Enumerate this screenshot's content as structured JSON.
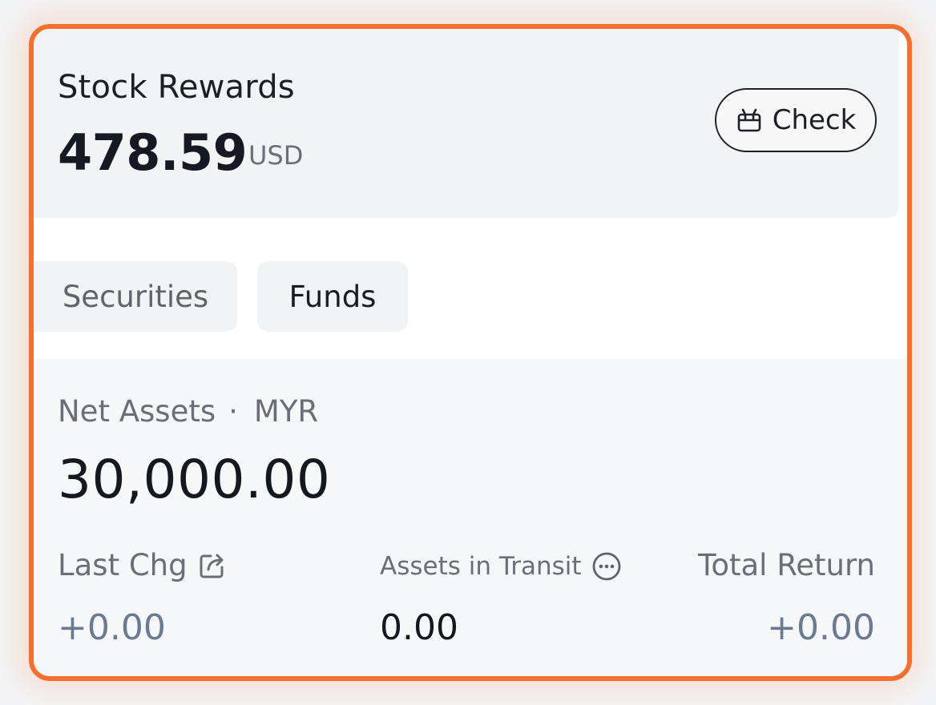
{
  "rewards": {
    "title": "Stock Rewards",
    "amount": "478.59",
    "currency": "USD",
    "check_label": "Check",
    "check_icon": "gift-icon"
  },
  "tabs": [
    {
      "label": "Securities",
      "selected": false
    },
    {
      "label": "Funds",
      "selected": true
    }
  ],
  "net_assets": {
    "label": "Net Assets",
    "separator": "·",
    "currency": "MYR",
    "value": "30,000.00"
  },
  "stats": {
    "last_chg": {
      "label": "Last Chg",
      "value": "+0.00",
      "icon": "share-icon"
    },
    "in_transit": {
      "label": "Assets in Transit",
      "value": "0.00",
      "icon": "more-circle-icon"
    },
    "total_return": {
      "label": "Total Return",
      "value": "+0.00"
    }
  },
  "colors": {
    "accent_border": "#f5702e",
    "panel_bg": "#f2f3f5",
    "muted_value": "#6b7a90"
  }
}
